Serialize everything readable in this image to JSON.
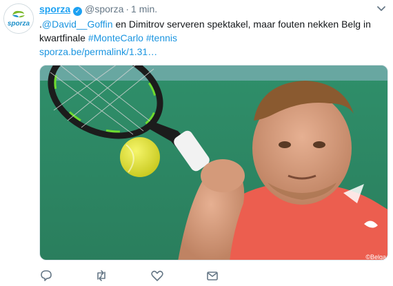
{
  "tweet": {
    "display_name": "sporza",
    "handle": "@sporza",
    "separator": "·",
    "time": "1 min.",
    "logo_text": "sporza",
    "text_prefix": ".",
    "mention": "@David__Goffin",
    "text_body": " en Dimitrov serveren spektakel, maar fouten nekken Belg in kwartfinale ",
    "hashtag1": "#MonteCarlo",
    "hashtag2": "#tennis",
    "link": "sporza.be/permalink/1.31…",
    "photo_credit": "©Belga"
  },
  "actions": {
    "reply": "reply-icon",
    "retweet": "retweet-icon",
    "like": "heart-icon",
    "dm": "envelope-icon"
  },
  "colors": {
    "accent": "#1da1f2",
    "link": "#1b95e0",
    "meta": "#657786",
    "brand_green": "#7ab829",
    "brand_blue": "#1b8fc9"
  }
}
